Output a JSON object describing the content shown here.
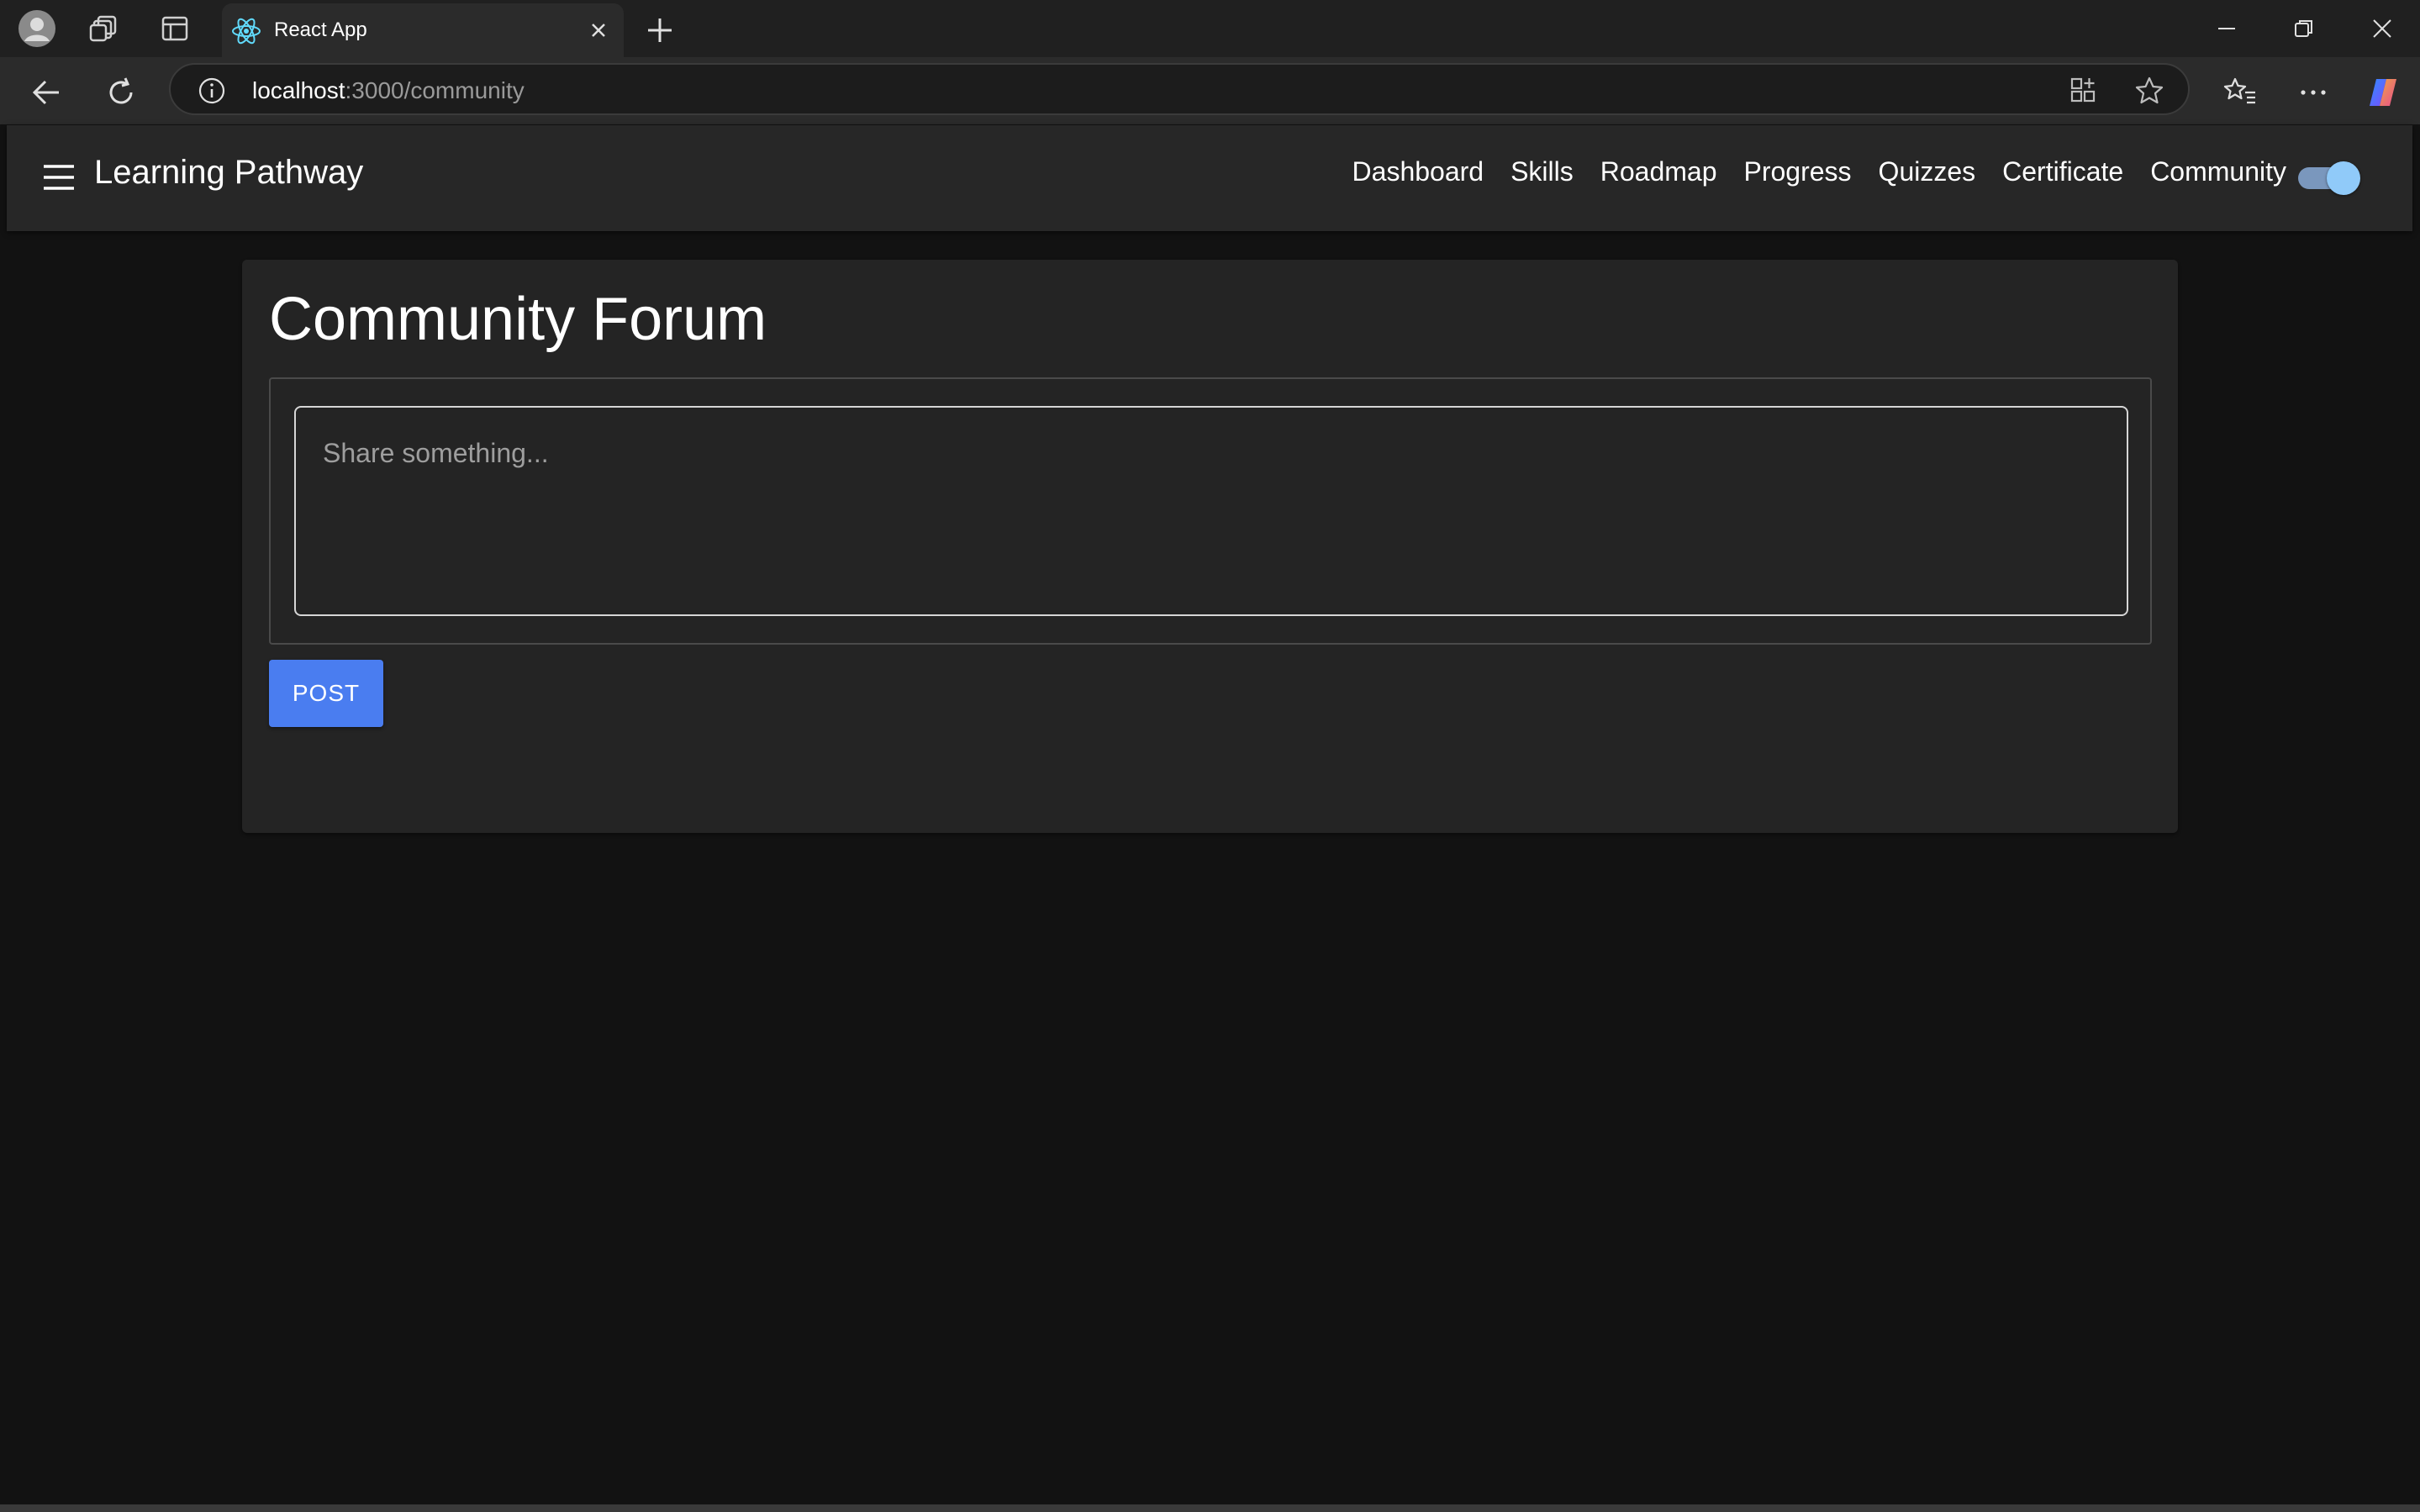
{
  "browser": {
    "tab_title": "React App",
    "url_host": "localhost",
    "url_rest": ":3000/community"
  },
  "app": {
    "brand": "Learning Pathway",
    "nav": [
      "Dashboard",
      "Skills",
      "Roadmap",
      "Progress",
      "Quizzes",
      "Certificate",
      "Community"
    ],
    "theme_toggle_on": true
  },
  "forum": {
    "title": "Community Forum",
    "input_placeholder": "Share something...",
    "input_value": "",
    "post_label": "POST"
  },
  "colors": {
    "page_bg": "#121212",
    "appbar_bg": "#272727",
    "card_bg": "#242424",
    "accent": "#4a7df0",
    "toggle_thumb": "#90caf9"
  }
}
